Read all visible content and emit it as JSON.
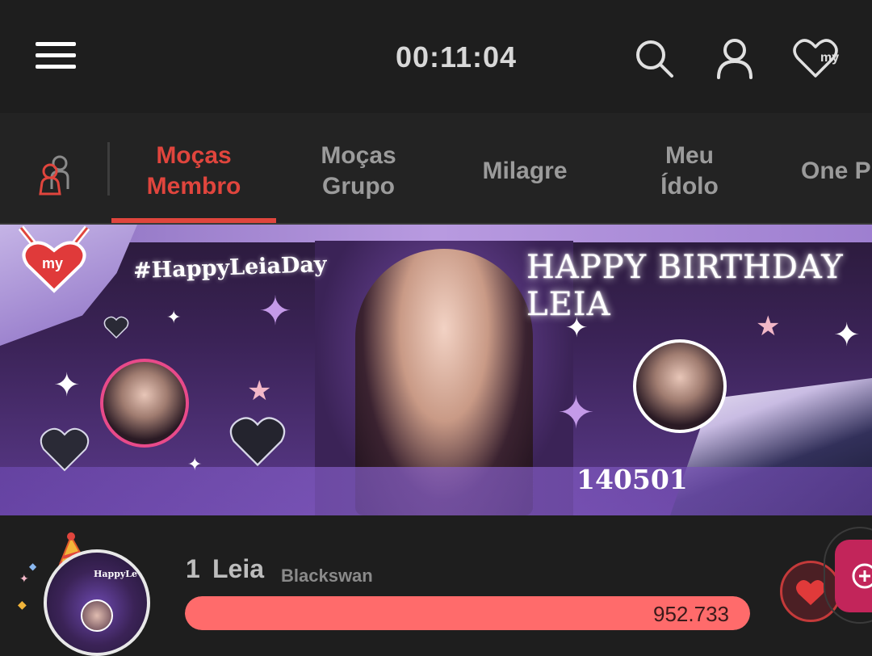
{
  "header": {
    "timer": "00:11:04",
    "icons": [
      "menu-icon",
      "search-icon",
      "user-icon",
      "my-heart-icon"
    ],
    "my_badge": "my"
  },
  "tabs": [
    {
      "line1": "Moças",
      "line2": "Membro",
      "active": true
    },
    {
      "line1": "Moças",
      "line2": "Grupo",
      "active": false
    },
    {
      "line1": "Milagre",
      "line2": "",
      "active": false
    },
    {
      "line1": "Meu",
      "line2": "Ídolo",
      "active": false
    },
    {
      "line1": "One P",
      "line2": "",
      "active": false
    }
  ],
  "banner": {
    "hashtag": "#HappyLeiaDay",
    "title": "HAPPY BIRTHDAY LEIA",
    "date": "140501",
    "badge": "my"
  },
  "ranking": {
    "rank": "1",
    "name": "Leia",
    "group": "Blackswan",
    "votes": "952.733",
    "fill_fraction": 1.0,
    "avatar_text": "HappyLe"
  },
  "colors": {
    "accent": "#e0453d",
    "bar": "#ff6b6b",
    "background": "#1e1e1e"
  }
}
